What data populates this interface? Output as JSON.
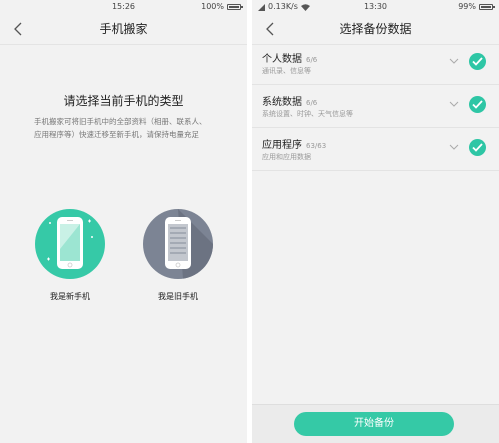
{
  "left_screen": {
    "status": {
      "time": "15:26",
      "battery": "100%",
      "battery_level": 1.0
    },
    "title": "手机搬家",
    "heading": "请选择当前手机的类型",
    "description": "手机搬家可将旧手机中的全部资料（相册、联系人、应用程序等）快速迁移至新手机，请保持电量充足",
    "choices": [
      {
        "label": "我是新手机",
        "color": "#36c9a7"
      },
      {
        "label": "我是旧手机",
        "color": "#7c8494"
      }
    ]
  },
  "right_screen": {
    "status": {
      "time": "13:30",
      "speed": "0.13K/s",
      "battery": "99%",
      "battery_level": 0.99
    },
    "title": "选择备份数据",
    "items": [
      {
        "title": "个人数据",
        "count": "6/6",
        "subtitle": "通讯录、信息等"
      },
      {
        "title": "系统数据",
        "count": "6/6",
        "subtitle": "系统设置、时钟、天气信息等"
      },
      {
        "title": "应用程序",
        "count": "63/63",
        "subtitle": "应用和应用数据"
      }
    ],
    "start_button": "开始备份"
  },
  "colors": {
    "accent": "#35c9a6",
    "old_phone": "#7c8494",
    "background": "#f2f2f2"
  }
}
